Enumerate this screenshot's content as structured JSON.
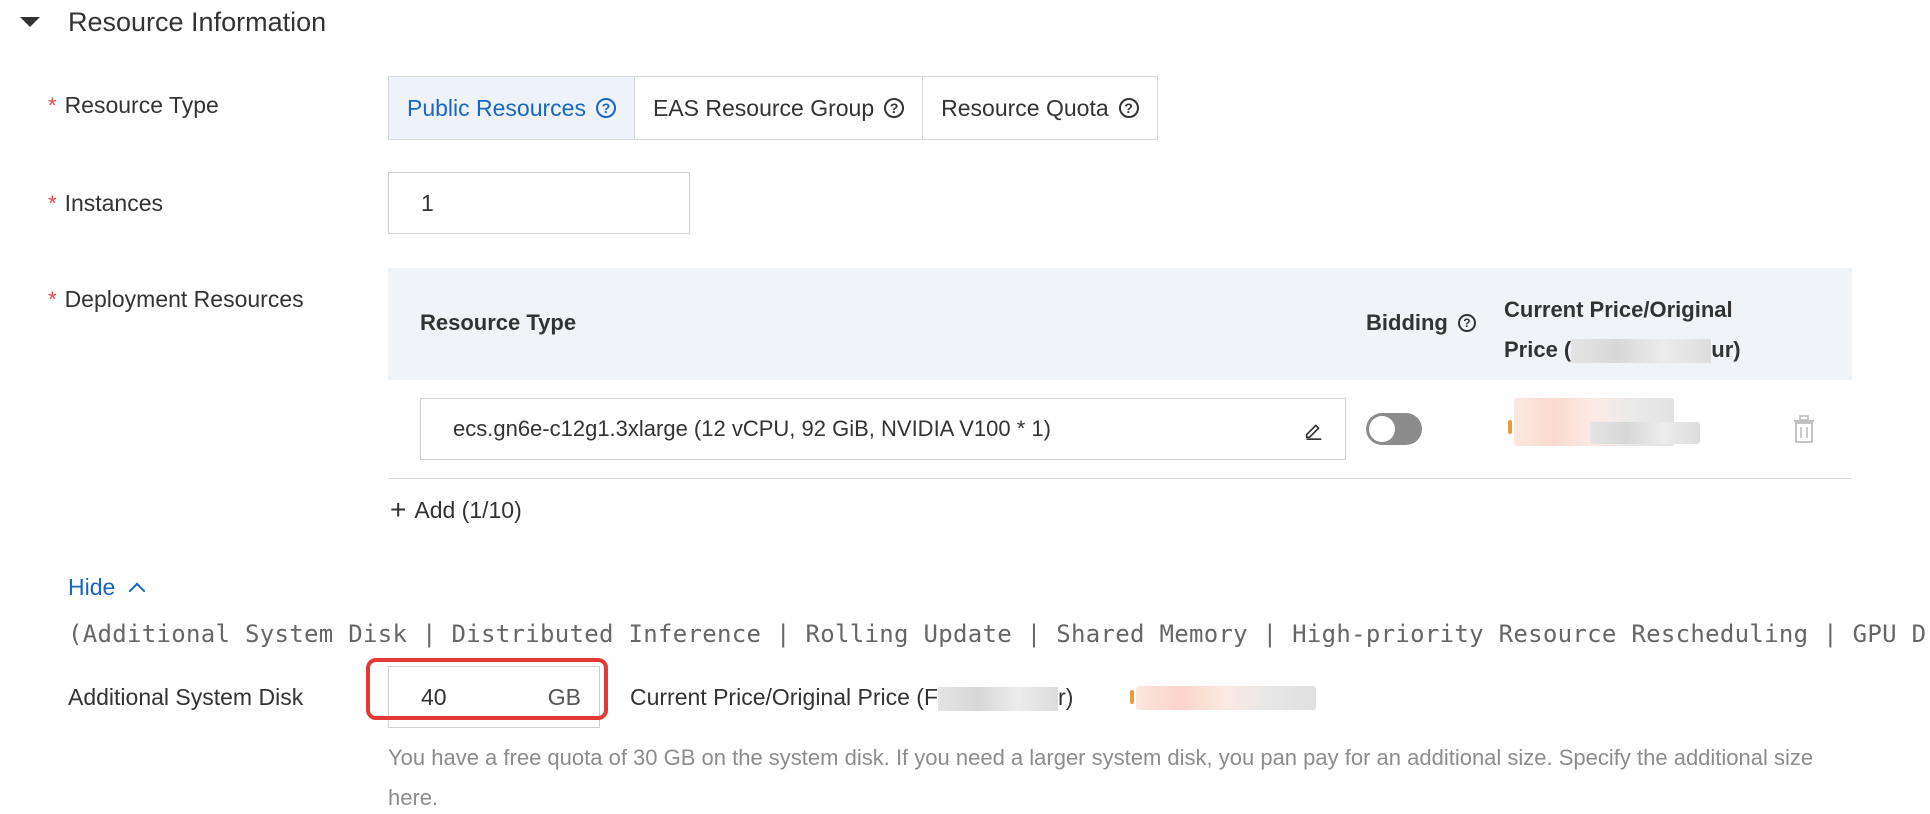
{
  "section": {
    "title": "Resource Information"
  },
  "resource_type": {
    "label": "Resource Type",
    "options": [
      {
        "label": "Public Resources",
        "active": true
      },
      {
        "label": "EAS Resource Group",
        "active": false
      },
      {
        "label": "Resource Quota",
        "active": false
      }
    ]
  },
  "instances": {
    "label": "Instances",
    "value": "1"
  },
  "deployment": {
    "label": "Deployment Resources",
    "columns": {
      "type": "Resource Type",
      "bidding": "Bidding",
      "price_line1": "Current Price/Original",
      "price_line2_prefix": "Price (",
      "price_line2_suffix": "ur)"
    },
    "rows": [
      {
        "type": "ecs.gn6e-c12g1.3xlarge  (12 vCPU, 92 GiB, NVIDIA V100 * 1)",
        "bidding": false
      }
    ],
    "add_label": "Add (1/10)"
  },
  "advanced": {
    "toggle_label": "Hide",
    "features_text": "(Additional System Disk | Distributed Inference | Rolling Update | Shared Memory | High-priority Resource Rescheduling | GPU Driv"
  },
  "system_disk": {
    "label": "Additional System Disk",
    "value": "40",
    "unit": "GB",
    "price_prefix": "Current Price/Original Price (F",
    "price_suffix": "r)",
    "hint": "You have a free quota of 30 GB on the system disk. If you need a larger system disk, you pan pay for an additional size. Specify the additional size here."
  },
  "colors": {
    "accent": "#1a66c4",
    "required": "#e5484d",
    "highlight": "#e53935"
  },
  "icons": {
    "collapse": "caret-down-icon",
    "help": "help-circle-icon",
    "edit": "edit-icon",
    "delete": "trash-icon",
    "add": "plus-icon",
    "hide": "chevron-up-icon"
  }
}
